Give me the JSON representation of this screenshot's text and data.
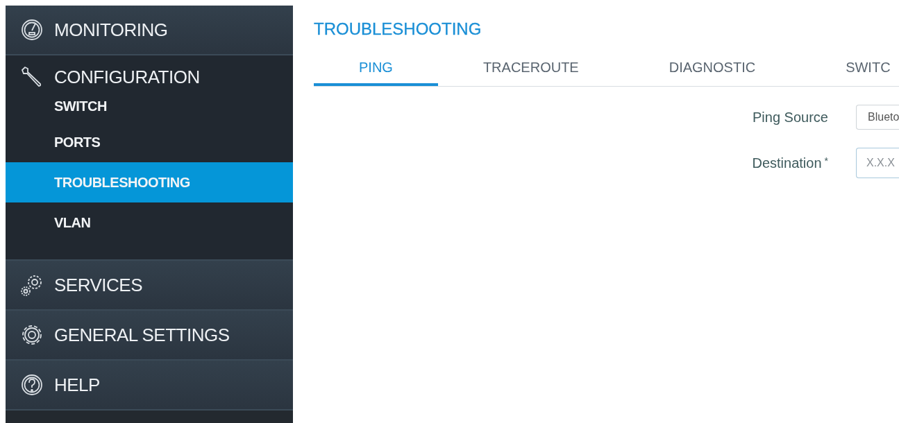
{
  "sidebar": {
    "items": [
      {
        "label": "MONITORING",
        "expanded": false
      },
      {
        "label": "CONFIGURATION",
        "expanded": true,
        "children": [
          {
            "label": "SWITCH",
            "selected": false
          },
          {
            "label": "PORTS",
            "selected": false
          },
          {
            "label": "TROUBLESHOOTING",
            "selected": true
          },
          {
            "label": "VLAN",
            "selected": false
          }
        ]
      },
      {
        "label": "SERVICES",
        "expanded": false
      },
      {
        "label": "GENERAL SETTINGS",
        "expanded": false
      },
      {
        "label": "HELP",
        "expanded": false
      }
    ]
  },
  "page_title": "TROUBLESHOOTING",
  "tabs": [
    {
      "label": "PING",
      "selected": true
    },
    {
      "label": "TRACEROUTE",
      "selected": false
    },
    {
      "label": "DIAGNOSTIC",
      "selected": false
    },
    {
      "label": "SWITC",
      "selected": false
    }
  ],
  "form": [
    {
      "label": "Ping Source",
      "kind": "select",
      "value": "Blueto"
    },
    {
      "label": "Destination",
      "required_mark": "*",
      "kind": "input",
      "placeholder": "X.X.X"
    }
  ]
}
